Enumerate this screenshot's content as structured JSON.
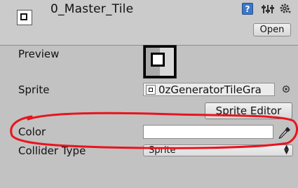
{
  "header": {
    "title": "0_Master_Tile",
    "help_label": "?",
    "open_button": "Open"
  },
  "preview": {
    "label": "Preview"
  },
  "sprite": {
    "label": "Sprite",
    "value": "0zGeneratorTileGra"
  },
  "sprite_editor_button": "Sprite Editor",
  "color": {
    "label": "Color",
    "value": "#ffffff"
  },
  "collider": {
    "label": "Collider Type",
    "selected": "Sprite"
  },
  "annotation": {
    "color": "#e8141e"
  }
}
